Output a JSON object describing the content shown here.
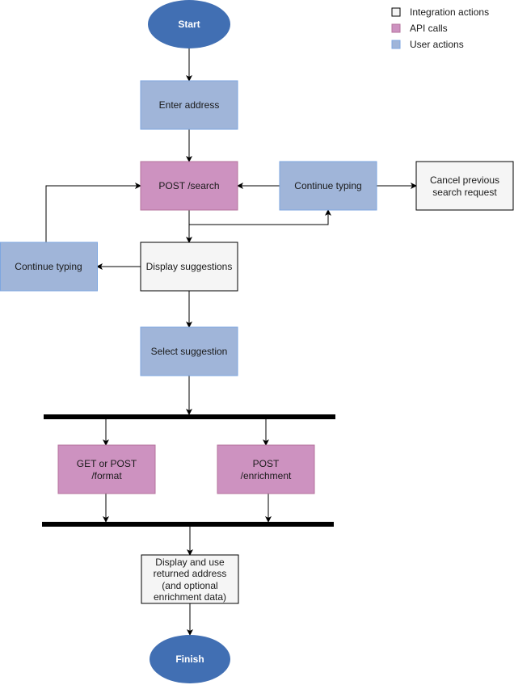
{
  "legend": [
    {
      "label": "Integration actions",
      "color": "#f5f5f5"
    },
    {
      "label": "API calls",
      "color": "#cd92c0"
    },
    {
      "label": "User actions",
      "color": "#a0b5d9"
    }
  ],
  "colors": {
    "terminal": "#416fb3",
    "user": "#a0b5d9",
    "api": "#cd92c0",
    "integration": "#f5f5f5"
  },
  "nodes": {
    "start": "Start",
    "enter_address": "Enter address",
    "post_search": "POST /search",
    "continue_typing_right": "Continue typing",
    "cancel_previous": [
      "Cancel previous",
      "search request"
    ],
    "continue_typing_left": "Continue typing",
    "display_suggestions": "Display suggestions",
    "select_suggestion": "Select suggestion",
    "get_or_post_format": [
      "GET or POST",
      "/format"
    ],
    "post_enrichment": [
      "POST",
      "/enrichment"
    ],
    "display_and_use": [
      "Display and use",
      "returned address",
      "(and optional",
      "enrichment data)"
    ],
    "finish": "Finish"
  }
}
